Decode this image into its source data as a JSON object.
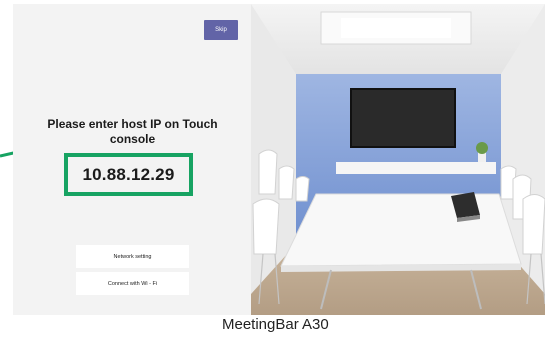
{
  "screen": {
    "skip_label": "Skip",
    "prompt": "Please enter host IP on Touch console",
    "host_ip": "10.88.12.29",
    "network_setting_label": "Network setting",
    "wifi_label": "Connect with Wi - Fi"
  },
  "caption": "MeetingBar A30",
  "colors": {
    "accent": "#6264a7",
    "highlight": "#17a362",
    "panel": "#f3f3f3",
    "wall": "#7f9fd6"
  },
  "icons": [
    "tv-screen-icon",
    "touch-console-icon",
    "plant-icon"
  ]
}
